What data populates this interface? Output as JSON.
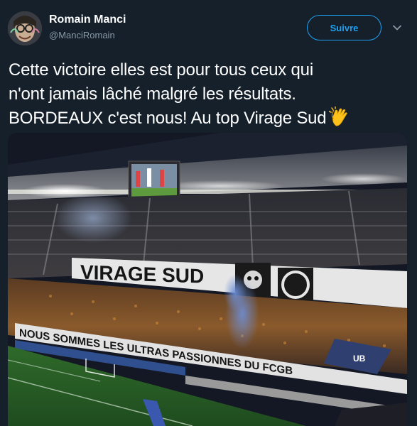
{
  "user": {
    "display_name": "Romain Manci",
    "handle": "@ManciRomain",
    "avatar_icon": "avatar"
  },
  "follow_button": {
    "label": "Suivre",
    "color": "#1da1f2"
  },
  "tweet": {
    "lines": [
      "Cette victoire elles est pour tous ceux qui",
      "n'ont jamais lâché malgré les résultats.",
      "BORDEAUX c'est nous! Au top Virage Sud"
    ],
    "emoji": "clapping-hands"
  },
  "photo": {
    "banner_top": "VIRAGE SUD",
    "banner_bottom": "NOUS SOMMES LES ULTRAS PASSIONNES DU FCGB",
    "flag_text": "UB"
  },
  "theme": {
    "background": "#15202b",
    "secondary_text": "#8899a6"
  }
}
